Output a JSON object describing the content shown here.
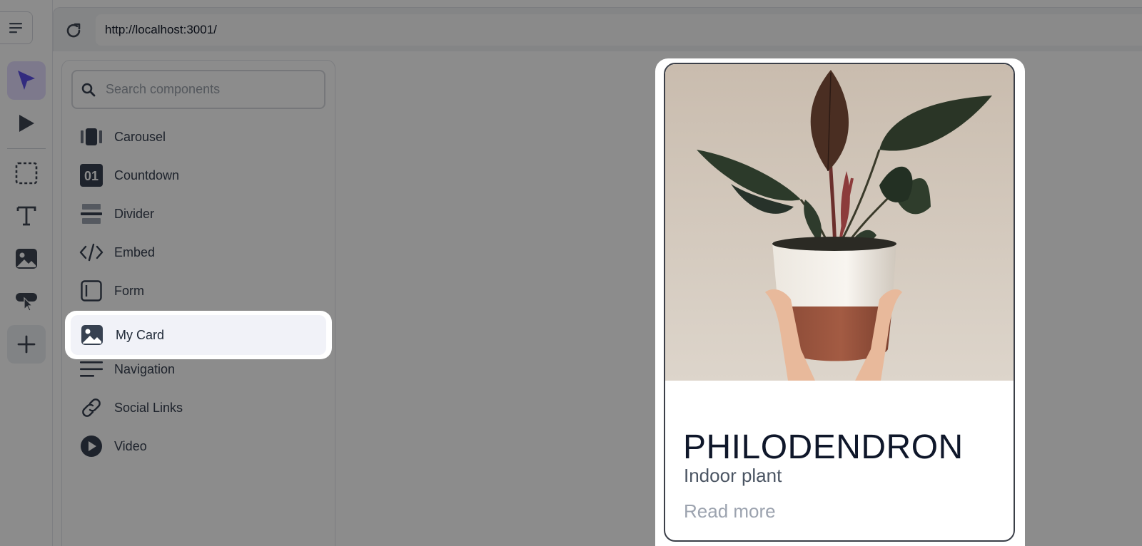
{
  "browser": {
    "url": "http://localhost:3001/"
  },
  "rail": {
    "tools": [
      {
        "icon": "pointer-icon"
      },
      {
        "icon": "play-icon"
      },
      {
        "icon": "section-icon"
      },
      {
        "icon": "text-icon"
      },
      {
        "icon": "image-icon"
      },
      {
        "icon": "button-icon"
      },
      {
        "icon": "plus-icon"
      }
    ]
  },
  "panel": {
    "search_placeholder": "Search components",
    "items": [
      {
        "label": "Carousel",
        "icon": "carousel-icon"
      },
      {
        "label": "Countdown",
        "icon": "countdown-icon",
        "badge": "01"
      },
      {
        "label": "Divider",
        "icon": "divider-icon"
      },
      {
        "label": "Embed",
        "icon": "code-icon"
      },
      {
        "label": "Form",
        "icon": "form-icon"
      },
      {
        "label": "My Card",
        "icon": "image-icon",
        "highlighted": true
      },
      {
        "label": "Navigation",
        "icon": "navigation-icon"
      },
      {
        "label": "Social Links",
        "icon": "link-icon"
      },
      {
        "label": "Video",
        "icon": "video-icon"
      }
    ]
  },
  "card": {
    "title": "PHILODENDRON",
    "subtitle": "Indoor plant",
    "link": "Read more"
  },
  "colors": {
    "accent": "#5b4fe8",
    "overlay": "rgba(0,0,0,0.45)",
    "card_border": "#3b3f48"
  }
}
